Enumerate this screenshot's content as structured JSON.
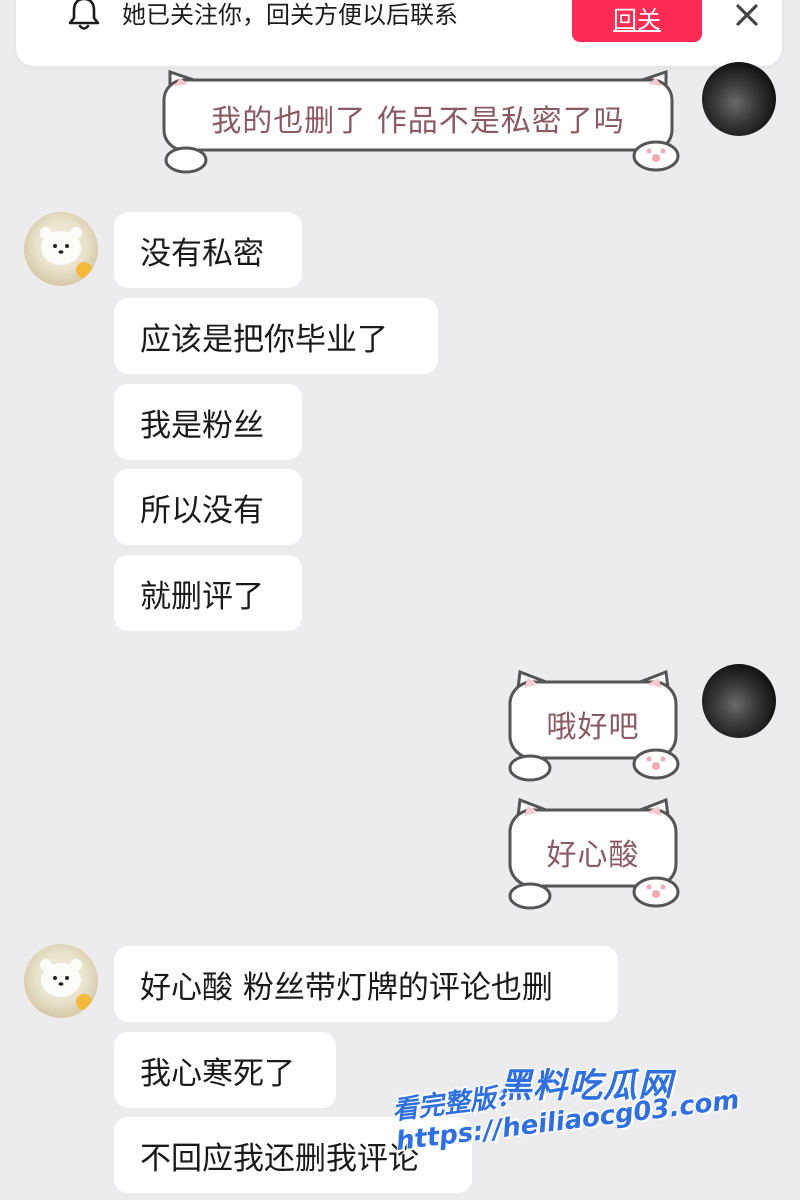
{
  "banner": {
    "text": "她已关注你，回关方便以后联系",
    "follow_label": "回关",
    "bell_icon": "bell-icon",
    "close_icon": "close-icon"
  },
  "messages": [
    {
      "side": "right",
      "text": "我的也删了 作品不是私密了吗"
    },
    {
      "side": "left",
      "text": "没有私密"
    },
    {
      "side": "left",
      "text": "应该是把你毕业了"
    },
    {
      "side": "left",
      "text": "我是粉丝"
    },
    {
      "side": "left",
      "text": "所以没有"
    },
    {
      "side": "left",
      "text": "就删评了"
    },
    {
      "side": "right",
      "text": "哦好吧"
    },
    {
      "side": "right",
      "text": "好心酸"
    },
    {
      "side": "left",
      "text": "好心酸 粉丝带灯牌的评论也删"
    },
    {
      "side": "left",
      "text": "我心寒死了"
    },
    {
      "side": "left",
      "text": "不回应我还删我评论"
    }
  ],
  "watermark": {
    "title": "黑料吃瓜网",
    "url": "看完整版：https://heiliaocg03.com"
  },
  "colors": {
    "accent": "#fe2c55",
    "background": "#ececee",
    "bubble": "#ffffff",
    "cat_text": "#8a5a63",
    "watermark": "#2f6fe0"
  }
}
